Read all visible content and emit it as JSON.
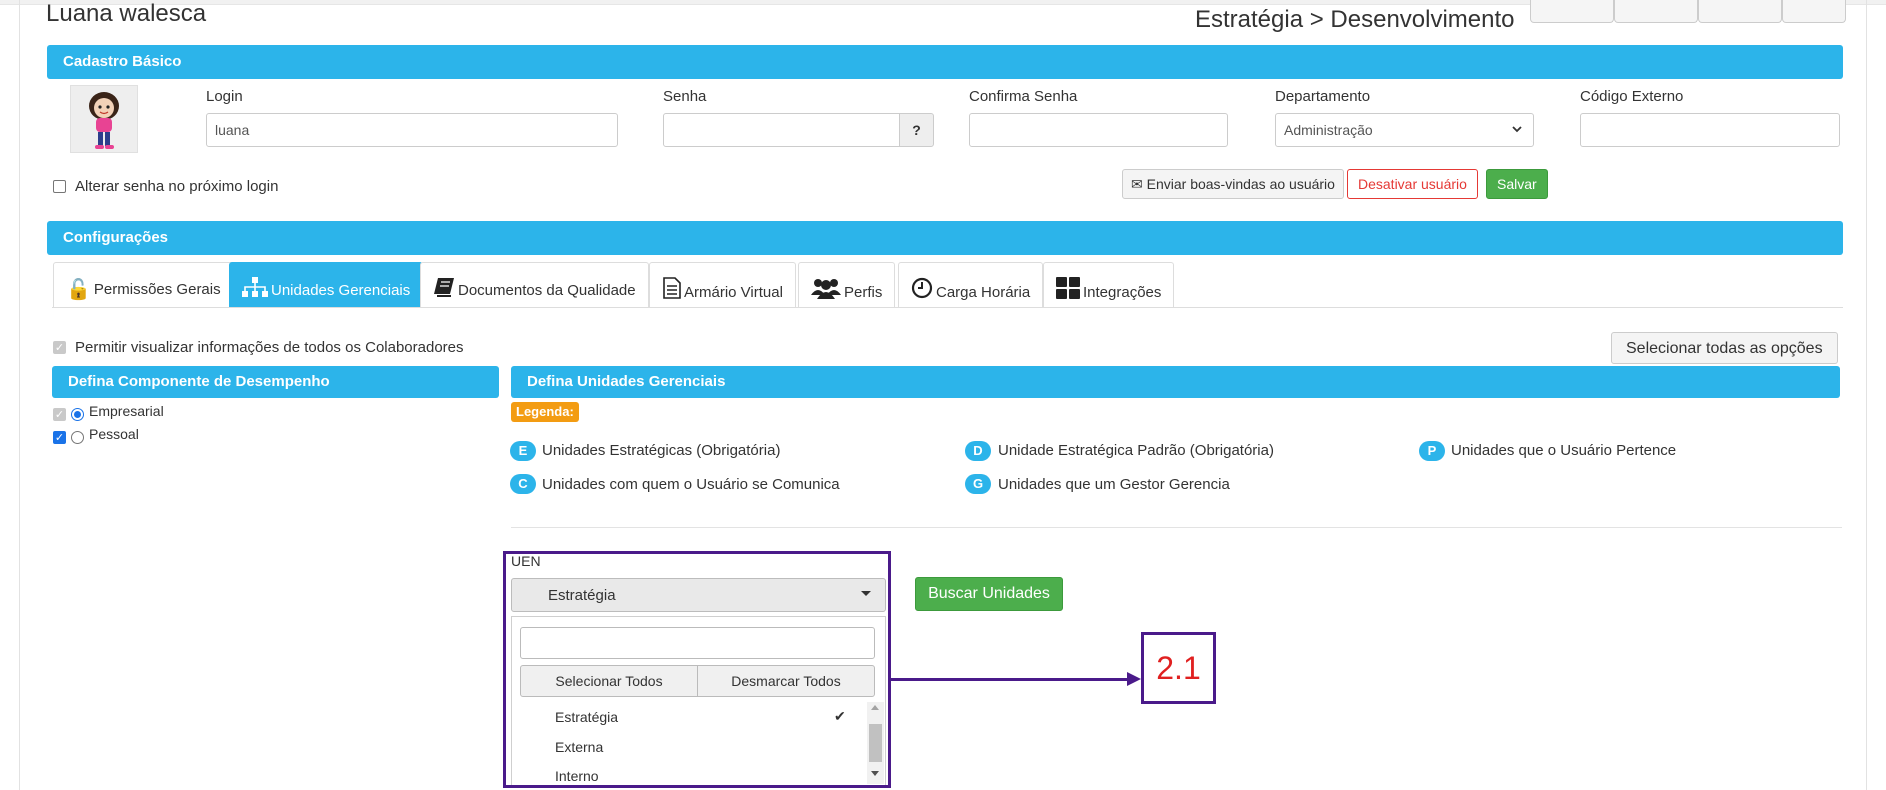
{
  "header": {
    "user_name": "Luana walesca",
    "breadcrumb": "Estratégia > Desenvolvimento"
  },
  "cadastro": {
    "title": "Cadastro Básico",
    "login_label": "Login",
    "login_value": "luana",
    "senha_label": "Senha",
    "senha_help": "?",
    "confirma_label": "Confirma Senha",
    "departamento_label": "Departamento",
    "departamento_value": "Administração",
    "codigo_label": "Código Externo",
    "alterar_senha_label": "Alterar senha no próximo login",
    "enviar_label": "Enviar boas-vindas ao usuário",
    "desativar_label": "Desativar usuário",
    "salvar_label": "Salvar"
  },
  "config": {
    "title": "Configurações",
    "tabs": [
      {
        "label": "Permissões Gerais",
        "icon": "unlock-icon",
        "active": false
      },
      {
        "label": "Unidades Gerenciais",
        "icon": "sitemap-icon",
        "active": true
      },
      {
        "label": "Documentos da Qualidade",
        "icon": "book-icon",
        "active": false
      },
      {
        "label": "Armário Virtual",
        "icon": "file-icon",
        "active": false
      },
      {
        "label": "Perfis",
        "icon": "users-icon",
        "active": false
      },
      {
        "label": "Carga Horária",
        "icon": "clock-icon",
        "active": false
      },
      {
        "label": "Integrações",
        "icon": "grid-icon",
        "active": false
      }
    ]
  },
  "unidades": {
    "permitir_label": "Permitir visualizar informações de todos os Colaboradores",
    "selecionar_todas_label": "Selecionar todas as opções",
    "componente_title": "Defina Componente de Desempenho",
    "empresarial_label": "Empresarial",
    "pessoal_label": "Pessoal",
    "unidades_title": "Defina Unidades Gerenciais",
    "legenda_label": "Legenda:",
    "legend": [
      {
        "badge": "E",
        "text": "Unidades Estratégicas (Obrigatória)"
      },
      {
        "badge": "D",
        "text": "Unidade Estratégica Padrão (Obrigatória)"
      },
      {
        "badge": "P",
        "text": "Unidades que o Usuário Pertence"
      },
      {
        "badge": "C",
        "text": "Unidades com quem o Usuário se Comunica"
      },
      {
        "badge": "G",
        "text": "Unidades que um Gestor Gerencia"
      }
    ],
    "uen_label": "UEN",
    "uen_selected": "Estratégia",
    "selecionar_todos_label": "Selecionar Todos",
    "desmarcar_todos_label": "Desmarcar Todos",
    "options": [
      "Estratégia",
      "Externa",
      "Interno"
    ],
    "buscar_label": "Buscar Unidades"
  },
  "annotation": {
    "label": "2.1",
    "color": "#4a1a8a",
    "text_color": "#e02020"
  },
  "colors": {
    "primary": "#2cb4ea",
    "success": "#4cae4c",
    "danger": "#e53935",
    "legend_badge": "#f39c12"
  }
}
